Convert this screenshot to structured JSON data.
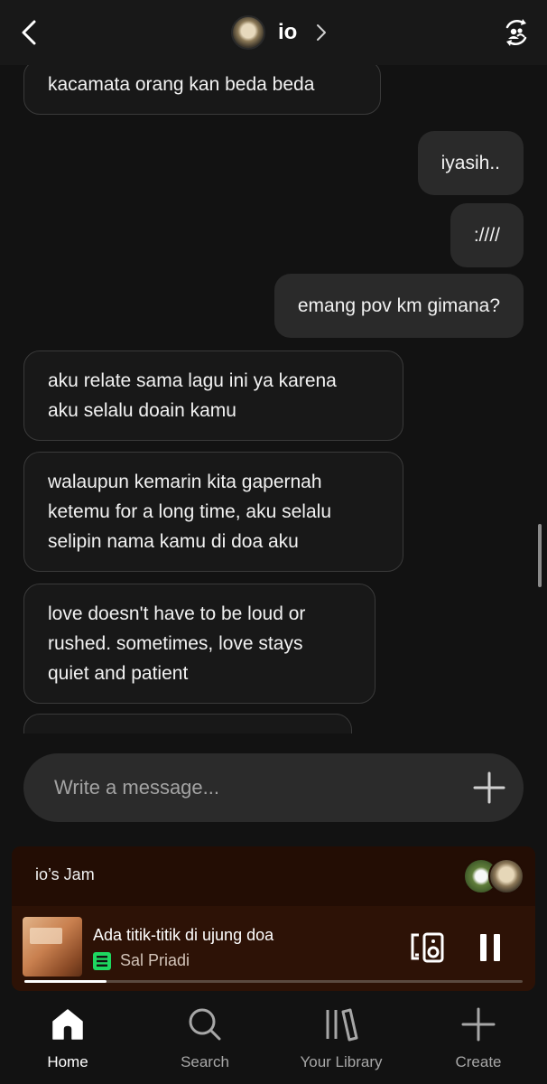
{
  "header": {
    "name": "io"
  },
  "messages": [
    {
      "side": "in",
      "text": "kacamata orang kan beda beda"
    },
    {
      "side": "out",
      "text": "iyasih.."
    },
    {
      "side": "out",
      "text": ":////"
    },
    {
      "side": "out",
      "text": "emang pov km gimana?"
    },
    {
      "side": "in",
      "lines": [
        "aku relate sama lagu ini ya karena",
        "aku selalu doain kamu"
      ]
    },
    {
      "side": "in",
      "lines": [
        "walaupun kemarin kita gapernah",
        "ketemu for a long time, aku selalu",
        "selipin nama kamu di doa aku"
      ]
    },
    {
      "side": "in",
      "lines": [
        "love doesn't have to be loud or",
        "rushed. sometimes, love stays",
        "quiet and patient"
      ]
    }
  ],
  "composer": {
    "placeholder": "Write a message..."
  },
  "player": {
    "jam_title": "io’s Jam",
    "track_title": "Ada titik-titik di ujung doa",
    "artist": "Sal Priadi",
    "progress": 0.165,
    "accent": "#1ed760"
  },
  "nav": {
    "items": [
      {
        "label": "Home",
        "icon": "home-icon",
        "active": true
      },
      {
        "label": "Search",
        "icon": "search-icon",
        "active": false
      },
      {
        "label": "Your Library",
        "icon": "library-icon",
        "active": false
      },
      {
        "label": "Create",
        "icon": "create-icon",
        "active": false
      }
    ]
  }
}
